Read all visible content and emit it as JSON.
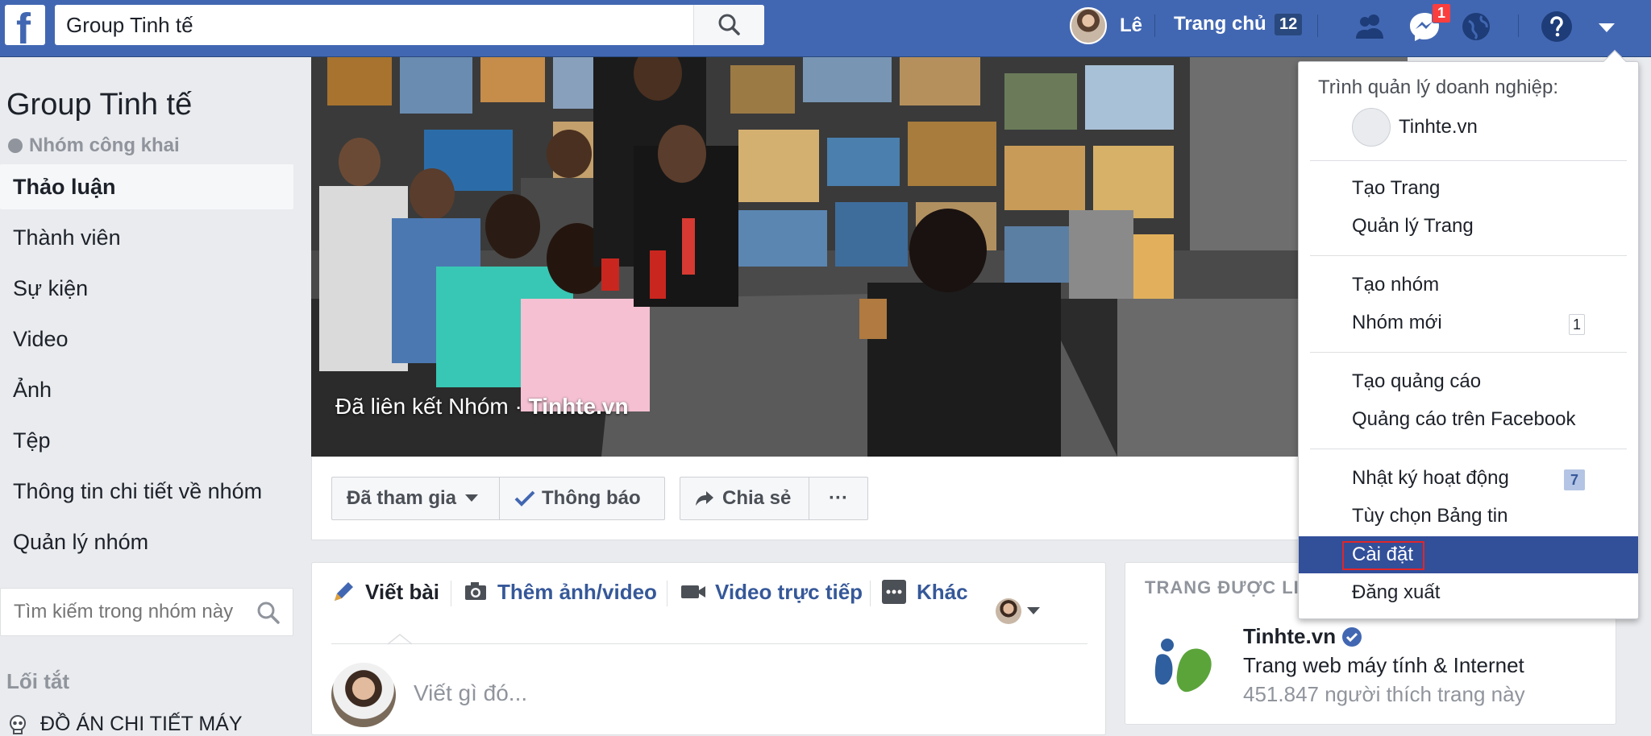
{
  "search": {
    "value": "Group Tinh tế"
  },
  "topnav": {
    "user_name": "Lê",
    "home_label": "Trang chủ",
    "home_count": "12",
    "messages_badge": "1"
  },
  "left": {
    "group_title": "Group Tinh tế",
    "group_type": "Nhóm công khai",
    "nav": [
      {
        "label": "Thảo luận"
      },
      {
        "label": "Thành viên"
      },
      {
        "label": "Sự kiện"
      },
      {
        "label": "Video"
      },
      {
        "label": "Ảnh"
      },
      {
        "label": "Tệp"
      },
      {
        "label": "Thông tin chi tiết về nhóm"
      },
      {
        "label": "Quản lý nhóm"
      }
    ],
    "search_placeholder": "Tìm kiếm trong nhóm này",
    "shortcuts_heading": "Lối tắt",
    "shortcut_item": "ĐỒ ÁN CHI TIẾT MÁY"
  },
  "cover": {
    "caption_prefix": "Đã liên kết Nhóm · ",
    "caption_page": "Tinhte.vn"
  },
  "actions": {
    "joined": "Đã tham gia",
    "notify": "Thông báo",
    "share": "Chia sẻ",
    "more": "···"
  },
  "composer": {
    "tabs": [
      "Viết bài",
      "Thêm ảnh/video",
      "Video trực tiếp",
      "Khác"
    ],
    "placeholder": "Viết gì đó..."
  },
  "linked_page": {
    "heading": "TRANG ĐƯỢC LIÊ",
    "name": "Tinhte.vn",
    "description": "Trang web máy tính & Internet",
    "likes": "451.847 người thích trang này"
  },
  "dropdown": {
    "business_heading": "Trình quản lý doanh nghiệp:",
    "business_page": "Tinhte.vn",
    "items": [
      {
        "label": "Tạo Trang"
      },
      {
        "label": "Quản lý Trang"
      },
      {
        "label": "Tạo nhóm"
      },
      {
        "label": "Nhóm mới",
        "badge": "1"
      },
      {
        "label": "Tạo quảng cáo"
      },
      {
        "label": "Quảng cáo trên Facebook"
      },
      {
        "label": "Nhật ký hoạt động",
        "badge": "7"
      },
      {
        "label": "Tùy chọn Bảng tin"
      },
      {
        "label": "Cài đặt"
      },
      {
        "label": "Đăng xuất"
      }
    ]
  },
  "colors": {
    "brand": "#4267b2",
    "selected_item": "#324f9a",
    "highlight_box": "#e0262b",
    "badge_red": "#fa3e3e"
  }
}
